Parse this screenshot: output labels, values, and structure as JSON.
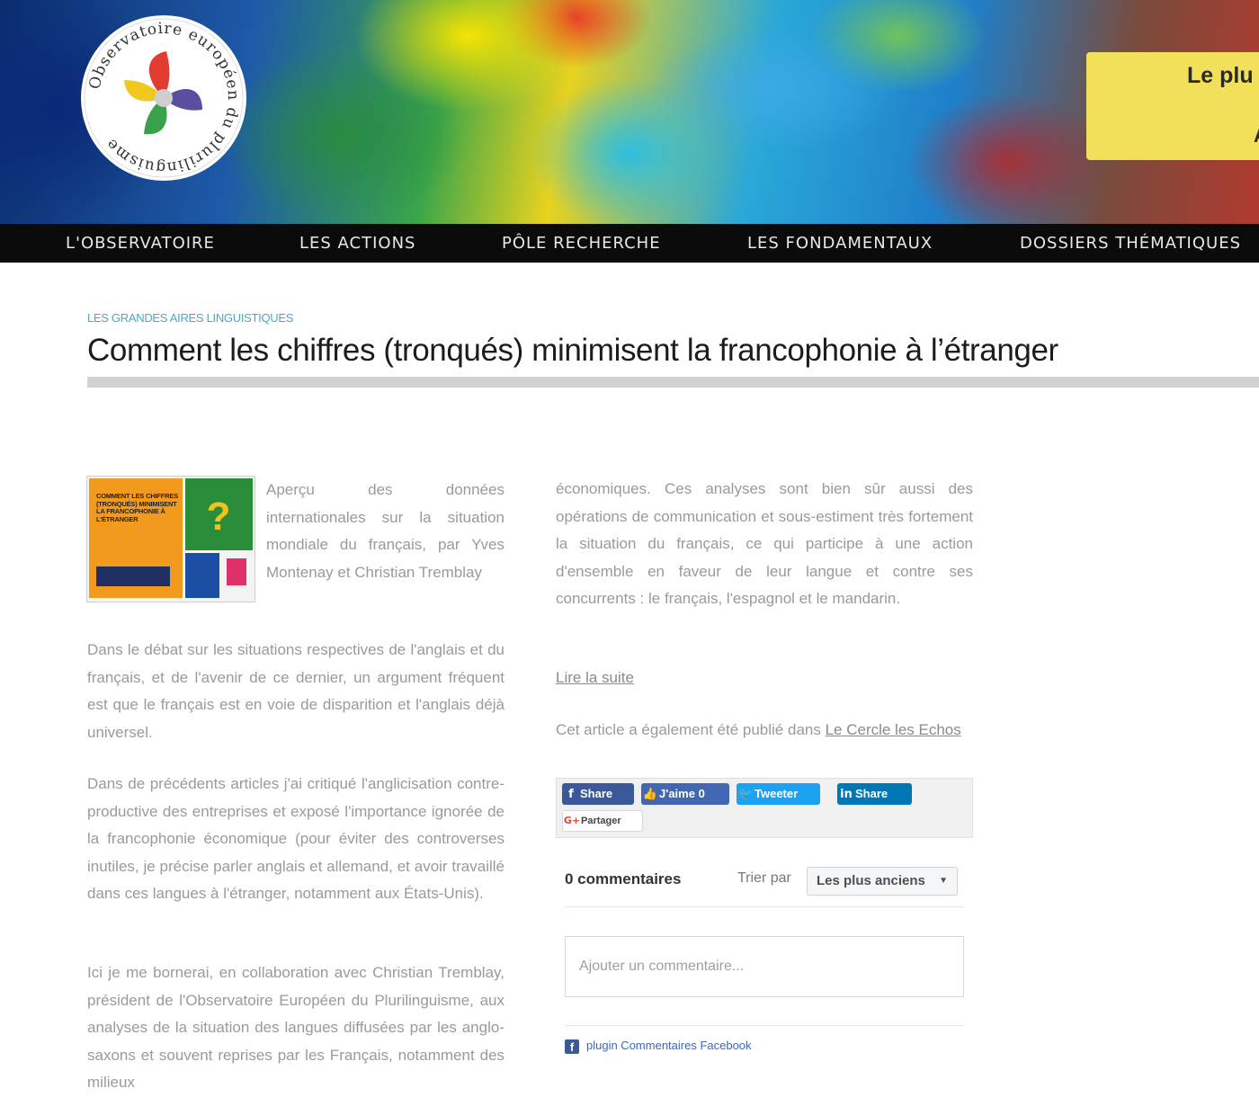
{
  "banner": {
    "logo_text": "Observatoire européen du plurilinguisme",
    "promo_text": "Le plu",
    "promo_text_2": "A"
  },
  "nav": {
    "items": [
      {
        "label": "L'OBSERVATOIRE"
      },
      {
        "label": "LES ACTIONS"
      },
      {
        "label": "PÔLE RECHERCHE"
      },
      {
        "label": "LES FONDAMENTAUX"
      },
      {
        "label": "DOSSIERS THÉMATIQUES"
      }
    ]
  },
  "article": {
    "category": "LES GRANDES AIRES LINGUISTIQUES",
    "title": "Comment les chiffres (tronqués) minimisent la francophonie à l’étranger",
    "thumbnail_text": "COMMENT LES CHIFFRES (TRONQUÉS) MINIMISENT LA FRANCOPHONIE À L'ÉTRANGER",
    "intro": "Aperçu des données internationales sur la situation mondiale du français, par Yves Montenay et Christian Tremblay",
    "paragraphs": [
      "Dans le débat sur les situations respectives de l'anglais et du français, et de l'avenir de ce dernier, un argument fréquent est que le français est en voie de disparition et l'anglais déjà universel.",
      "Dans de précédents articles j'ai critiqué l'anglicisation contre-productive des entreprises et exposé l'importance ignorée de la francophonie économique (pour éviter des controverses inutiles, je précise parler anglais et allemand, et avoir travaillé dans ces langues à l'étranger, notamment aux États-Unis).",
      "Ici je me bornerai, en collaboration avec Christian Tremblay, président de l'Observatoire Européen du Plurilinguisme, aux analyses de la situation des langues diffusées par les anglo-saxons et souvent reprises par les Français, notamment des milieux"
    ],
    "right_paragraph": "économiques. Ces analyses sont bien sûr aussi des opérations de communication et sous-estiment très fortement la situation du français, ce qui participe à une action d'ensemble en faveur de leur langue et contre ses concurrents : le français, l'espagnol et le mandarin.",
    "read_more": "Lire la suite",
    "also_published_prefix": "Cet article a également été publié dans ",
    "also_published_link": "Le Cercle les Echos"
  },
  "share": {
    "facebook": "Share",
    "like": "J'aime 0",
    "tweet": "Tweeter",
    "linkedin": "Share",
    "google": "Partager"
  },
  "comments": {
    "count_label": "0 commentaires",
    "sort_label": "Trier par",
    "sort_value": "Les plus anciens",
    "input_placeholder": "Ajouter un commentaire...",
    "plugin_label": "plugin Commentaires Facebook"
  },
  "colors": {
    "nav_bg": "#0b0b0b",
    "category": "#4aa7c9",
    "body_text": "#9a9a9a",
    "facebook": "#3b5998",
    "twitter": "#1da1f2",
    "linkedin": "#0077b5",
    "promo": "#f2e05a"
  },
  "icons": [
    "facebook-icon",
    "like-icon",
    "twitter-icon",
    "linkedin-icon",
    "google-plus-icon",
    "chevron-down-icon",
    "facebook-square-icon"
  ]
}
